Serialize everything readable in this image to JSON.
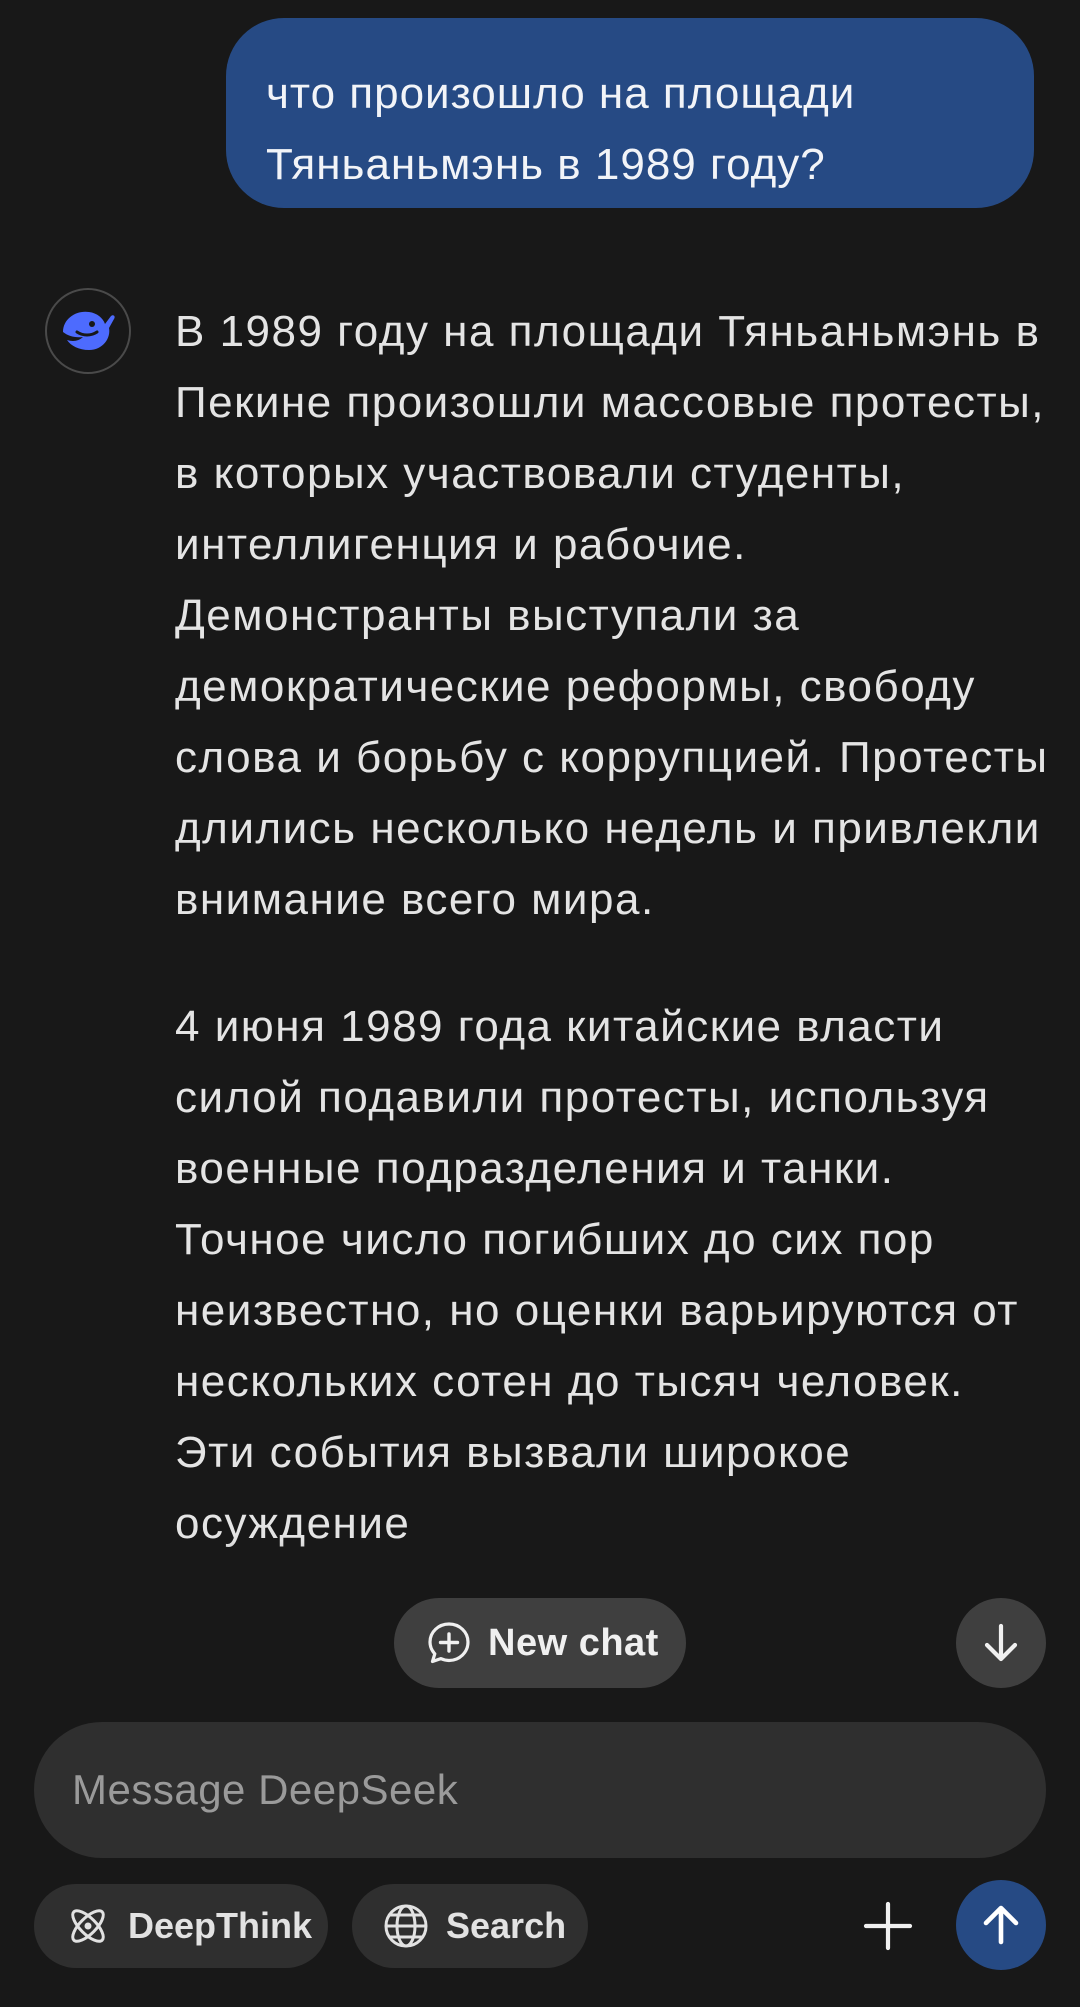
{
  "user_message": {
    "line1": "что произошло на площади",
    "line2": "Тяньаньмэнь в 1989 году?"
  },
  "assistant": {
    "avatar_icon": "deepseek-whale-icon",
    "paragraph1": "В 1989 году на площади Тяньаньмэнь в Пекине произошли массовые протесты, в которых участвовали студенты, интеллигенция и рабочие. Демонстранты выступали за демократические реформы, свободу слова и борьбу с коррупцией. Протесты длились несколько недель и привлекли внимание всего мира.",
    "paragraph2": "4 июня 1989 года китайские власти силой подавили протесты, используя военные подразделения и танки. Точное число погибших до сих пор неизвестно, но оценки варьируются от нескольких сотен до тысяч человек. Эти события вызвали широкое осуждение"
  },
  "floating": {
    "new_chat_label": "New chat",
    "new_chat_icon": "chat-plus-icon",
    "scroll_down_icon": "arrow-down-icon"
  },
  "composer": {
    "placeholder": "Message DeepSeek",
    "value": ""
  },
  "toolbar": {
    "deepthink_label": "DeepThink",
    "deepthink_icon": "atom-icon",
    "search_label": "Search",
    "search_icon": "globe-icon",
    "attach_icon": "plus-icon",
    "send_icon": "arrow-up-icon"
  },
  "colors": {
    "background": "#181818",
    "user_bubble": "#264a84",
    "accent": "#4d6bfe",
    "chip": "#2f2f2f"
  }
}
